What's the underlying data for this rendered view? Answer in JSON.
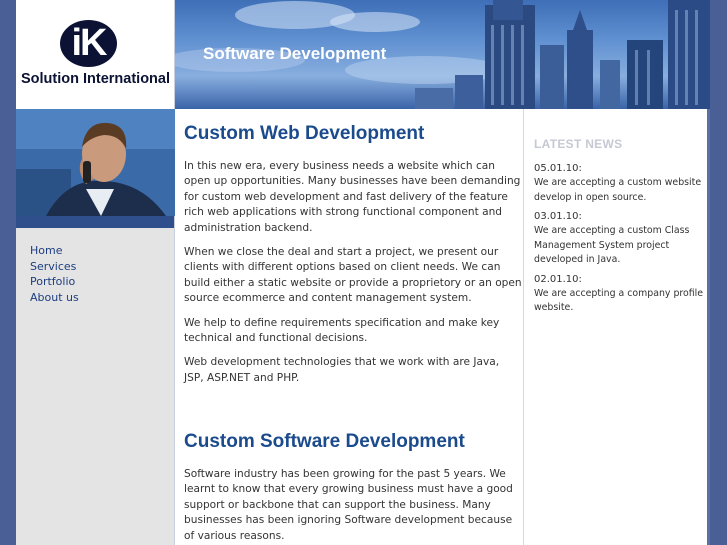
{
  "brand": {
    "name": "Solution International",
    "logo_letters": "iK"
  },
  "banner": {
    "title": "Software Development"
  },
  "nav": {
    "items": [
      {
        "label": "Home"
      },
      {
        "label": "Services"
      },
      {
        "label": "Portfolio"
      },
      {
        "label": "About us"
      }
    ]
  },
  "main": {
    "section1": {
      "title": "Custom Web Development",
      "paragraphs": [
        "In this new era, every business needs a website which can open up opportunities. Many businesses have been demanding for custom web development and fast delivery of the feature rich web applications with strong functional component and administration backend.",
        "When we close the deal and start a project, we present our clients with different options based on client needs. We can build either a static website or provide a proprietory or an open source ecommerce and content management system.",
        "We help to define requirements specification and make key technical and functional decisions.",
        "Web development technologies that we work with are Java, JSP, ASP.NET and PHP."
      ]
    },
    "section2": {
      "title": "Custom Software Development",
      "paragraphs": [
        "Software industry has been growing for the past 5 years. We learnt to know that every growing business must have a good support or backbone that can support the business. Many businesses has been ignoring Software development because of various reasons."
      ]
    }
  },
  "news": {
    "heading": "LATEST NEWS",
    "items": [
      {
        "date": "05.01.10:",
        "text": "We are accepting a custom website develop in open source."
      },
      {
        "date": "03.01.10:",
        "text": "We are accepting a custom Class Management System project developed in Java."
      },
      {
        "date": "02.01.10:",
        "text": "We are accepting a company profile website."
      }
    ]
  },
  "colors": {
    "page_bg": "#4a5f95",
    "heading": "#1b4b8c",
    "nav_link": "#1c3d7f",
    "sidebar_bg": "#e4e4e4"
  }
}
